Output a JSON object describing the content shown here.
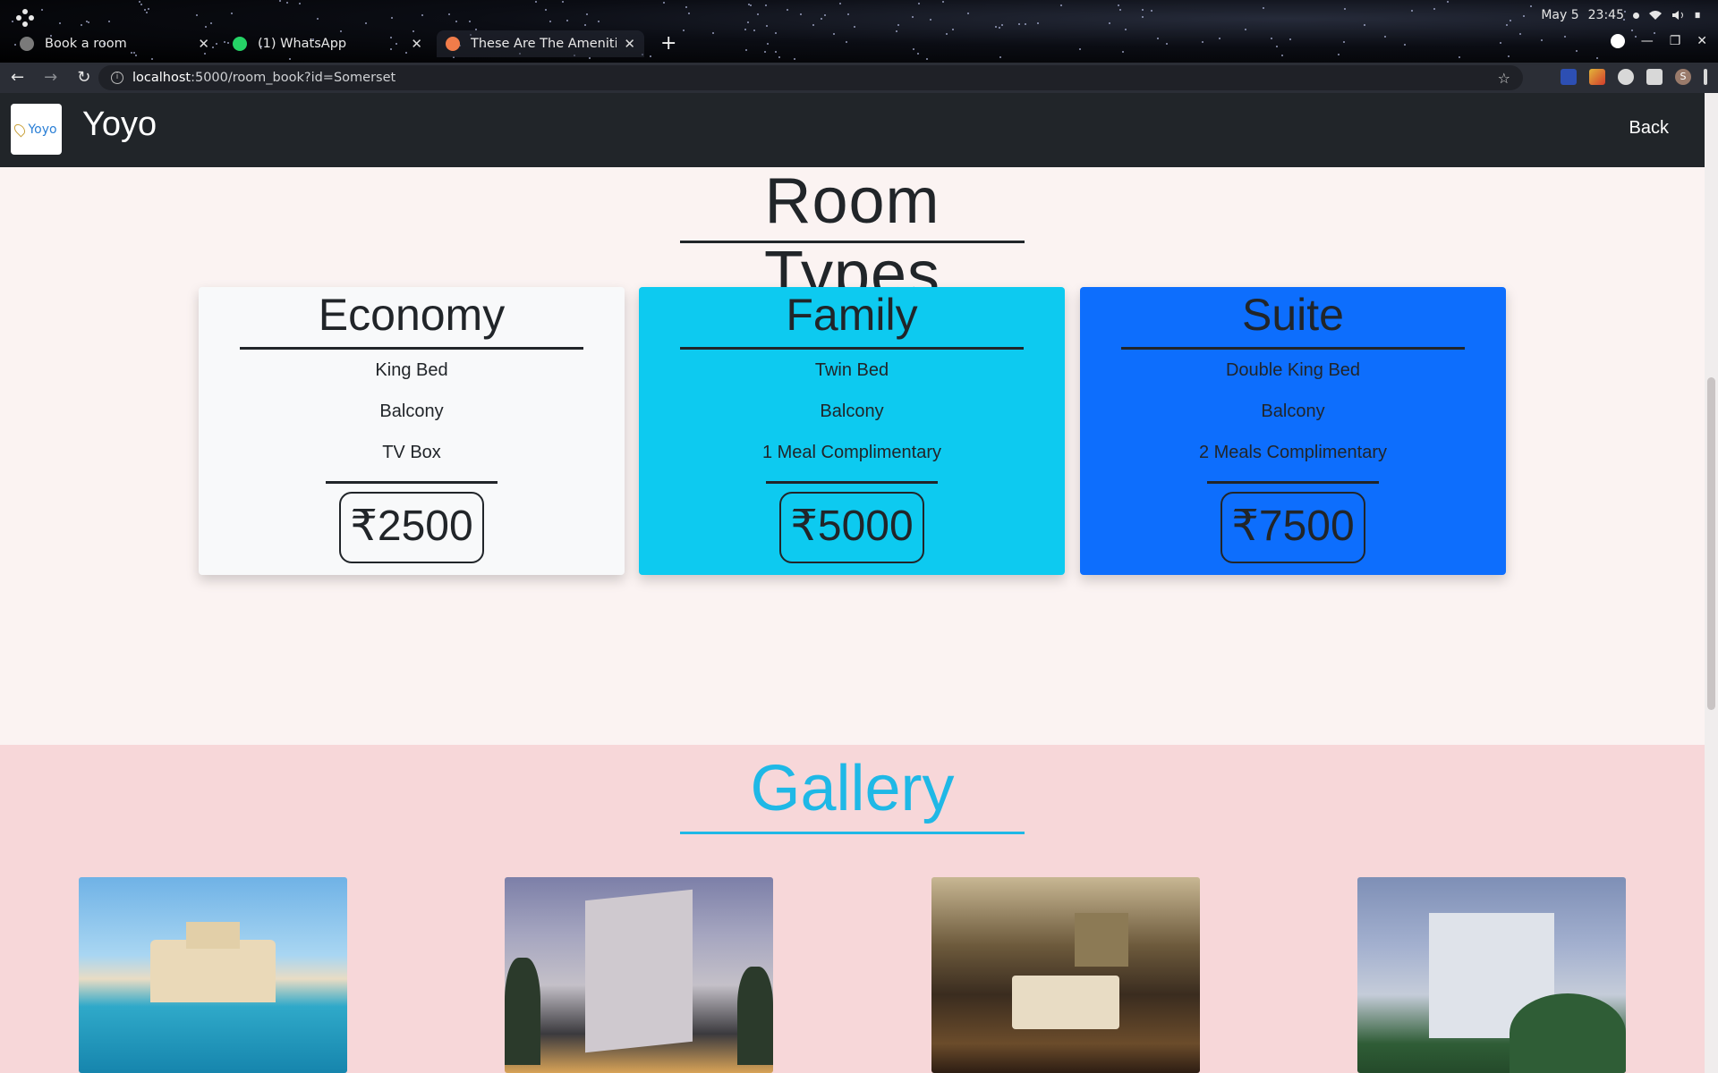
{
  "os": {
    "date": "May 5",
    "time": "23:45"
  },
  "tabs": [
    {
      "title": "Book a room",
      "favicon_color": "#888888"
    },
    {
      "title": "(1) WhatsApp",
      "favicon_color": "#25d366"
    },
    {
      "title": "These Are The Amenities I",
      "favicon_color": "#f07c4a"
    }
  ],
  "address": {
    "host": "localhost",
    "path": ":5000/room_book?id=Somerset"
  },
  "navbar": {
    "logo_text": "Yoyo",
    "brand": "Yoyo",
    "back_label": "Back"
  },
  "room_types": {
    "title": "Room Types",
    "cards": [
      {
        "name": "Economy",
        "features": [
          "King Bed",
          "Balcony",
          "TV Box"
        ],
        "price": "₹2500",
        "color": "#f8f9fa"
      },
      {
        "name": "Family",
        "features": [
          "Twin Bed",
          "Balcony",
          "1 Meal Complimentary"
        ],
        "price": "₹5000",
        "color": "#0dcaf0"
      },
      {
        "name": "Suite",
        "features": [
          "Double King Bed",
          "Balcony",
          "2 Meals Complimentary"
        ],
        "price": "₹7500",
        "color": "#0d6efd"
      }
    ]
  },
  "gallery": {
    "title": "Gallery",
    "images": [
      "beach-hotel-image",
      "tower-hotel-image",
      "hotel-room-image",
      "city-hotel-image"
    ]
  }
}
